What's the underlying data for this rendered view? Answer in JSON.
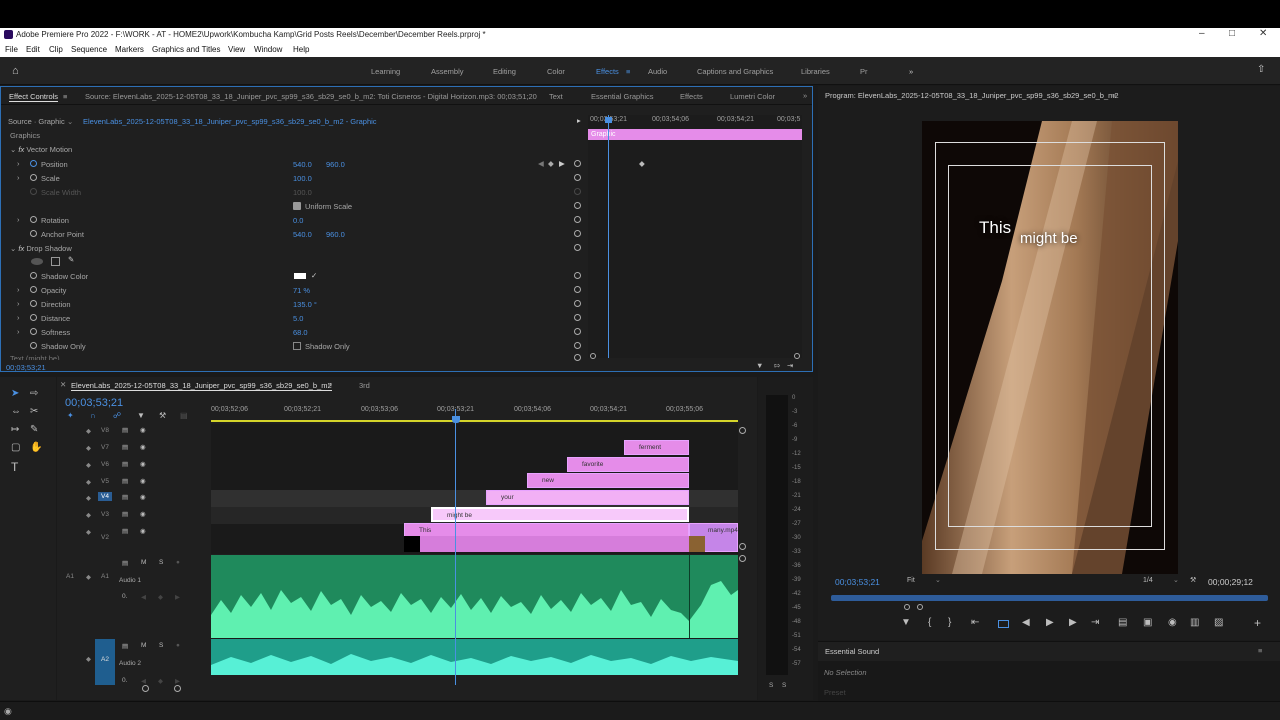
{
  "window": {
    "title": "Adobe Premiere Pro 2022 - F:\\WORK - AT - HOME2\\Upwork\\Kombucha Kamp\\Grid Posts Reels\\December\\December Reels.prproj *"
  },
  "menu": [
    "File",
    "Edit",
    "Clip",
    "Sequence",
    "Markers",
    "Graphics and Titles",
    "View",
    "Window",
    "Help"
  ],
  "workspaces": [
    "Learning",
    "Assembly",
    "Editing",
    "Color",
    "Effects",
    "Audio",
    "Captions and Graphics",
    "Libraries",
    "Pr"
  ],
  "left_tabs": {
    "effect_controls": "Effect Controls",
    "source": "Source: ElevenLabs_2025-12-05T08_33_18_Juniper_pvc_sp99_s36_sb29_se0_b_m2: Toti Cisneros - Digital Horizon.mp3: 00;03;51;20",
    "text": "Text",
    "essential_graphics": "Essential Graphics",
    "effects": "Effects",
    "lumetri": "Lumetri Color"
  },
  "ec": {
    "source_label": "Source · Graphic",
    "clip_name": "ElevenLabs_2025-12-05T08_33_18_Juniper_pvc_sp99_s36_sb29_se0_b_m2 - Graphic",
    "graphics": "Graphics",
    "vector_motion": "Vector Motion",
    "position": "Position",
    "pos_x": "540.0",
    "pos_y": "960.0",
    "scale": "Scale",
    "scale_val": "100.0",
    "scale_width": "Scale Width",
    "scale_width_val": "100.0",
    "uniform_scale": "Uniform Scale",
    "rotation": "Rotation",
    "rotation_val": "0.0",
    "anchor": "Anchor Point",
    "anchor_x": "540.0",
    "anchor_y": "960.0",
    "drop_shadow": "Drop Shadow",
    "shadow_color": "Shadow Color",
    "opacity": "Opacity",
    "opacity_val": "71 %",
    "direction": "Direction",
    "direction_val": "135.0 °",
    "distance": "Distance",
    "distance_val": "5.0",
    "softness": "Softness",
    "softness_val": "68.0",
    "shadow_only": "Shadow Only",
    "text_row": "Text (might be)",
    "mini_tc": [
      "00;03;53;21",
      "00;03;54;06",
      "00;03;54;21",
      "00;03;5"
    ],
    "graphic_bar": "Graphic",
    "time": "00;03;53;21"
  },
  "program": {
    "title": "Program: ElevenLabs_2025-12-05T08_33_18_Juniper_pvc_sp99_s36_sb29_se0_b_m2",
    "caption_a": "This",
    "caption_b": "might be",
    "time": "00;03;53;21",
    "fit": "Fit",
    "ratio": "1/4",
    "duration": "00;00;29;12"
  },
  "essential_sound": {
    "title": "Essential Sound",
    "no_selection": "No Selection",
    "preset": "Preset"
  },
  "timeline": {
    "tab": "ElevenLabs_2025-12-05T08_33_18_Juniper_pvc_sp99_s36_sb29_se0_b_m2",
    "tab2": "3rd",
    "time": "00;03;53;21",
    "ruler": [
      "00;03;52;06",
      "00;03;52;21",
      "00;03;53;06",
      "00;03;53;21",
      "00;03;54;06",
      "00;03;54;21",
      "00;03;55;06"
    ],
    "video_tracks": [
      "V8",
      "V7",
      "V6",
      "V5",
      "V4",
      "V3",
      "V2"
    ],
    "audio_tracks": [
      {
        "id": "A1",
        "name": "Audio 1"
      },
      {
        "id": "A2",
        "name": "Audio 2"
      }
    ],
    "clips": [
      "ferment",
      "favorite",
      "new",
      "your",
      "might be",
      "This",
      "many.mp4"
    ],
    "vol": "0."
  },
  "meter": [
    "0",
    "-3",
    "-6",
    "-9",
    "-12",
    "-15",
    "-18",
    "-21",
    "-24",
    "-27",
    "-30",
    "-33",
    "-36",
    "-39",
    "-42",
    "-45",
    "-48",
    "-51",
    "-54",
    "-57"
  ],
  "meter_ss": "S",
  "colors": {
    "accent": "#4a90e2",
    "graphic": "#e58ce9",
    "audio": "#2bbf83"
  }
}
